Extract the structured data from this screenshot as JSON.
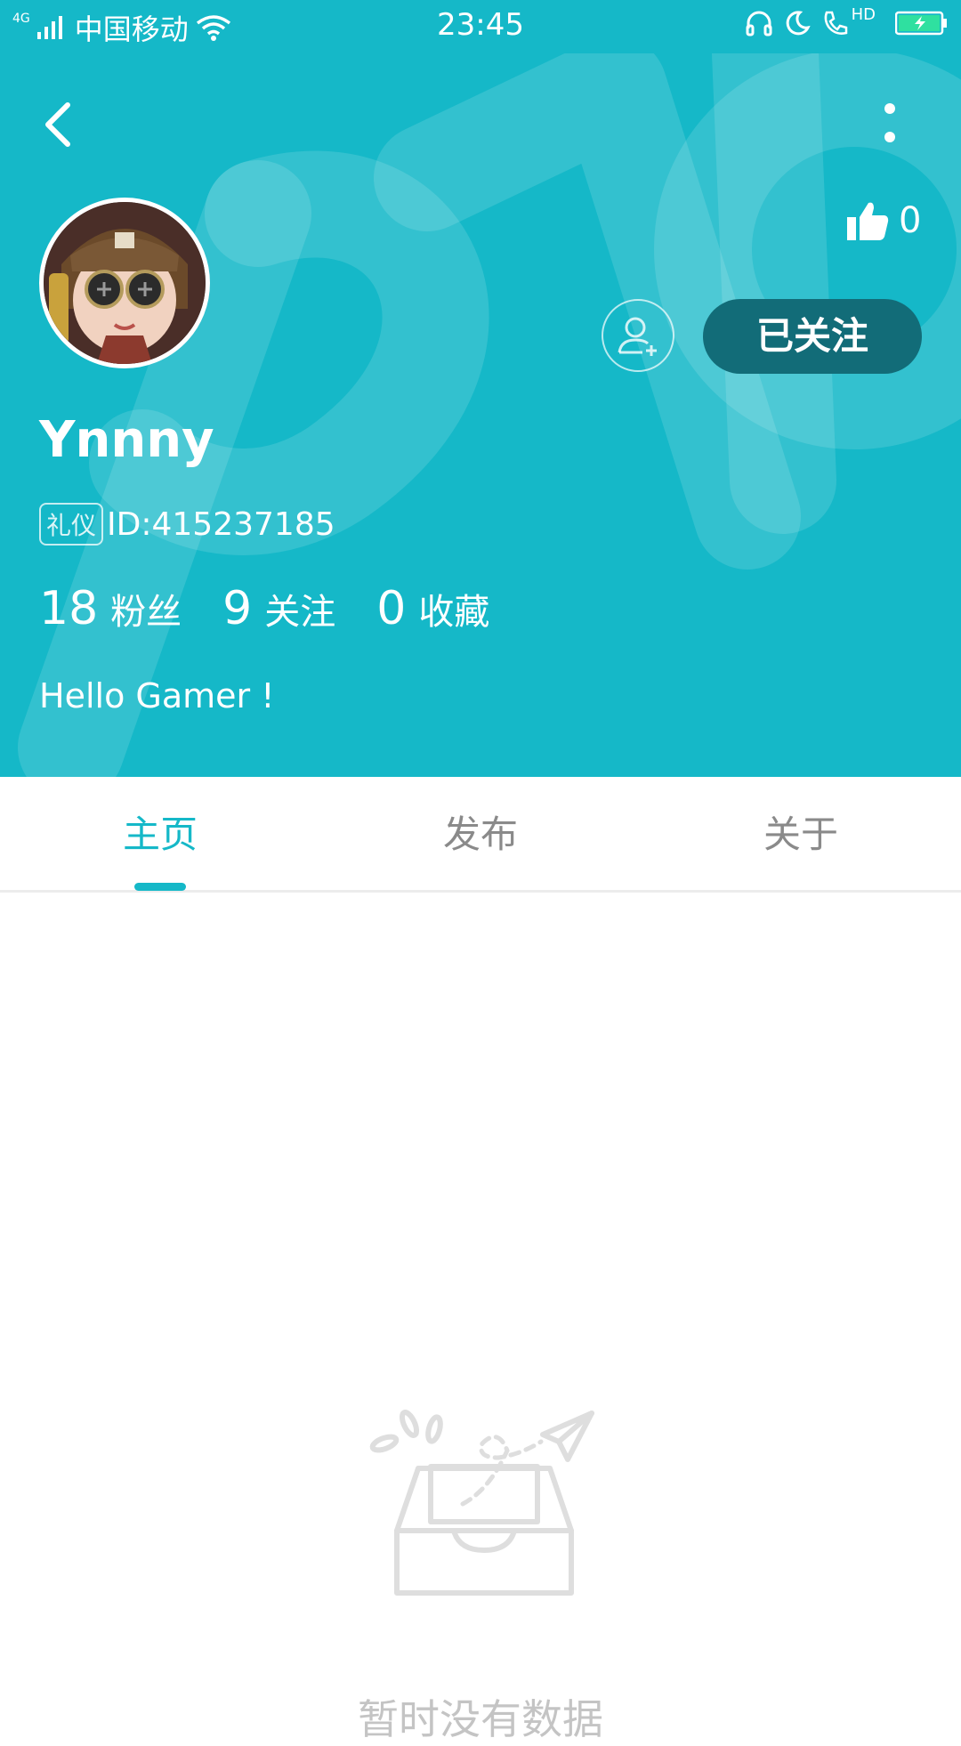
{
  "status_bar": {
    "network_type": "4G",
    "carrier": "中国移动",
    "time": "23:45",
    "hd_label": "HD"
  },
  "colors": {
    "header_bg": "#15b8c8",
    "followed_button_bg": "#126c78",
    "accent": "#15b8c8"
  },
  "profile": {
    "like_count": "0",
    "add_friend_icon": "user-plus-icon",
    "followed_label": "已关注",
    "username": "Ynnny",
    "role_badge": "礼仪",
    "user_id": "ID:415237185",
    "stats": [
      {
        "value": "18",
        "label": "粉丝"
      },
      {
        "value": "9",
        "label": "关注"
      },
      {
        "value": "0",
        "label": "收藏"
      }
    ],
    "bio": "Hello Gamer !"
  },
  "tabs": [
    {
      "label": "主页",
      "active": true
    },
    {
      "label": "发布",
      "active": false
    },
    {
      "label": "关于",
      "active": false
    }
  ],
  "empty_state": {
    "icon": "empty-inbox-icon",
    "text": "暂时没有数据"
  }
}
